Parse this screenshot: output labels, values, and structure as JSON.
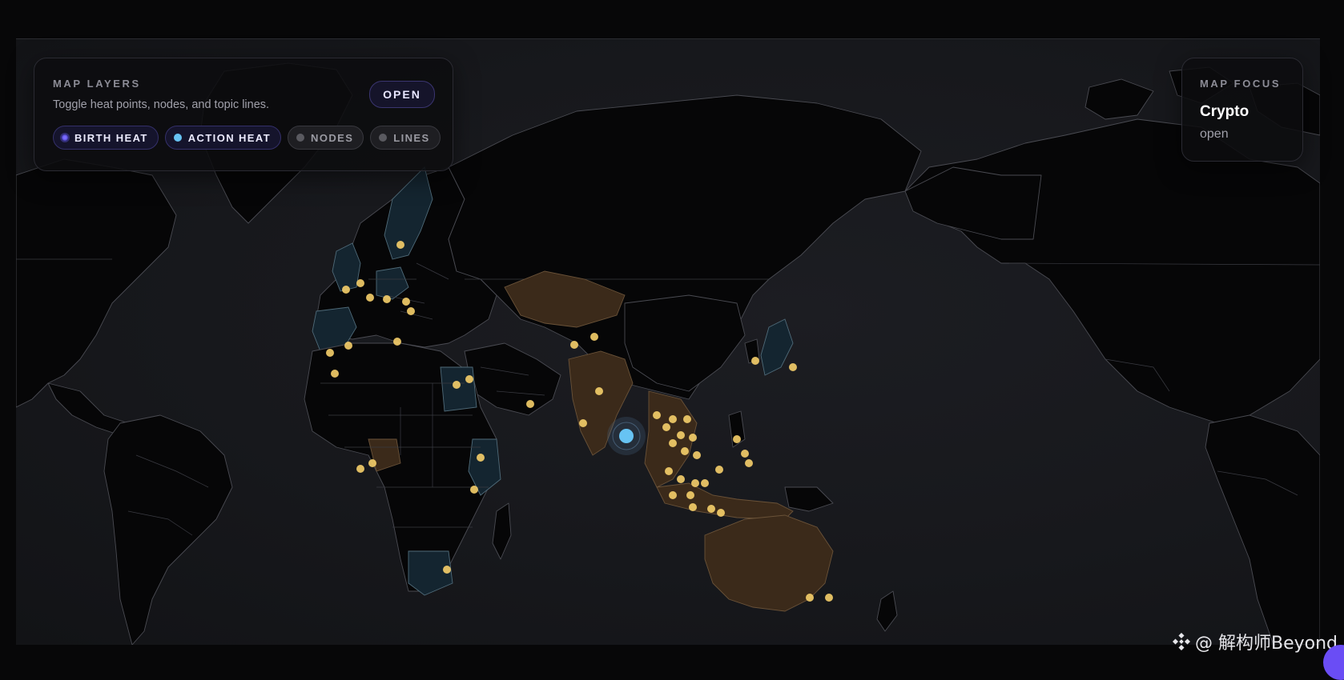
{
  "map_layers": {
    "title": "MAP LAYERS",
    "subtitle": "Toggle heat points, nodes, and topic lines.",
    "open_button": "OPEN",
    "chips": [
      {
        "label": "BIRTH HEAT",
        "active": true,
        "icon": "birth-heat-icon"
      },
      {
        "label": "ACTION HEAT",
        "active": true,
        "icon": "action-heat-icon"
      },
      {
        "label": "NODES",
        "active": false,
        "icon": "nodes-icon"
      },
      {
        "label": "LINES",
        "active": false,
        "icon": "lines-icon"
      }
    ]
  },
  "map_focus": {
    "title": "MAP FOCUS",
    "topic": "Crypto",
    "status": "open"
  },
  "watermark": "@ 解构师Beyond",
  "colors": {
    "background": "#070708",
    "land": "#060607",
    "highlight_blue": "#142530",
    "highlight_brown": "#3b2a1a",
    "heat_point": "#f6cf6a",
    "action_point": "#67c3f3",
    "accent": "#6e62ff"
  }
}
